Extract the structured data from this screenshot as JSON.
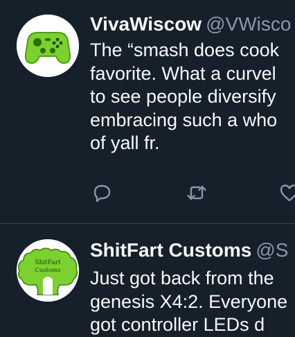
{
  "tweets": [
    {
      "author_name": "VivaWiscow",
      "author_handle": "@VWisco",
      "avatar_icon": "green-game-controller-avatar",
      "text_lines": [
        "The “smash does cook",
        "favorite. What a curvel",
        "to see people diversify",
        "embracing such a who",
        "of yall fr."
      ],
      "actions": [
        "reply-icon",
        "retweet-icon",
        "like-icon"
      ]
    },
    {
      "author_name": "ShitFart Customs",
      "author_handle": "@S",
      "avatar_icon": "shitfart-customs-logo-avatar",
      "avatar_logo_lines": [
        "ShitFart",
        "Customs"
      ],
      "text_lines": [
        "Just got back from the",
        "genesis X4:2. Everyone",
        "got controller LEDs d"
      ]
    }
  ],
  "colors": {
    "background": "#15202b",
    "text": "#f7f9f9",
    "muted": "#8b98a5",
    "divider": "#38444d",
    "avatar_green": "#7bd12f"
  }
}
